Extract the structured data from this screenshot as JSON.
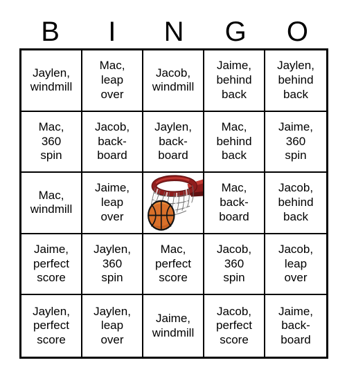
{
  "card": {
    "title": "BINGO",
    "header_letters": [
      "B",
      "I",
      "N",
      "G",
      "O"
    ],
    "colors": {
      "border": "#000000",
      "background": "#ffffff",
      "text": "#000000",
      "rim": "#8f1d1d",
      "rim_highlight": "#c23a33",
      "rim_dark": "#5e1111",
      "ball_light": "#e8913f",
      "ball_mid": "#d9702a",
      "ball_dark": "#b4531c",
      "net": "#f2f2f2",
      "net_line": "#6b6b6b"
    },
    "grid": {
      "rows": 5,
      "columns": 5,
      "cells": [
        {
          "id": "b1",
          "text": "Jaylen,\nwindmill",
          "type": "text"
        },
        {
          "id": "i1",
          "text": "Mac,\nleap\nover",
          "type": "text"
        },
        {
          "id": "n1",
          "text": "Jacob,\nwindmill",
          "type": "text"
        },
        {
          "id": "g1",
          "text": "Jaime,\nbehind\nback",
          "type": "text"
        },
        {
          "id": "o1",
          "text": "Jaylen,\nbehind\nback",
          "type": "text"
        },
        {
          "id": "b2",
          "text": "Mac,\n360\nspin",
          "type": "text"
        },
        {
          "id": "i2",
          "text": "Jacob,\nback-\nboard",
          "type": "text"
        },
        {
          "id": "n2",
          "text": "Jaylen,\nback-\nboard",
          "type": "text"
        },
        {
          "id": "g2",
          "text": "Mac,\nbehind\nback",
          "type": "text"
        },
        {
          "id": "o2",
          "text": "Jaime,\n360\nspin",
          "type": "text"
        },
        {
          "id": "b3",
          "text": "Mac,\nwindmill",
          "type": "text"
        },
        {
          "id": "i3",
          "text": "Jaime,\nleap\nover",
          "type": "text"
        },
        {
          "id": "n3",
          "text": "",
          "type": "image",
          "image_name": "basketball-hoop-free-space"
        },
        {
          "id": "g3",
          "text": "Mac,\nback-\nboard",
          "type": "text"
        },
        {
          "id": "o3",
          "text": "Jacob,\nbehind\nback",
          "type": "text"
        },
        {
          "id": "b4",
          "text": "Jaime,\nperfect\nscore",
          "type": "text"
        },
        {
          "id": "i4",
          "text": "Jaylen,\n360\nspin",
          "type": "text"
        },
        {
          "id": "n4",
          "text": "Mac,\nperfect\nscore",
          "type": "text"
        },
        {
          "id": "g4",
          "text": "Jacob,\n360\nspin",
          "type": "text"
        },
        {
          "id": "o4",
          "text": "Jacob,\nleap\nover",
          "type": "text"
        },
        {
          "id": "b5",
          "text": "Jaylen,\nperfect\nscore",
          "type": "text"
        },
        {
          "id": "i5",
          "text": "Jaylen,\nleap\nover",
          "type": "text"
        },
        {
          "id": "n5",
          "text": "Jaime,\nwindmill",
          "type": "text"
        },
        {
          "id": "g5",
          "text": "Jacob,\nperfect\nscore",
          "type": "text"
        },
        {
          "id": "o5",
          "text": "Jaime,\nback-\nboard",
          "type": "text"
        }
      ]
    }
  }
}
